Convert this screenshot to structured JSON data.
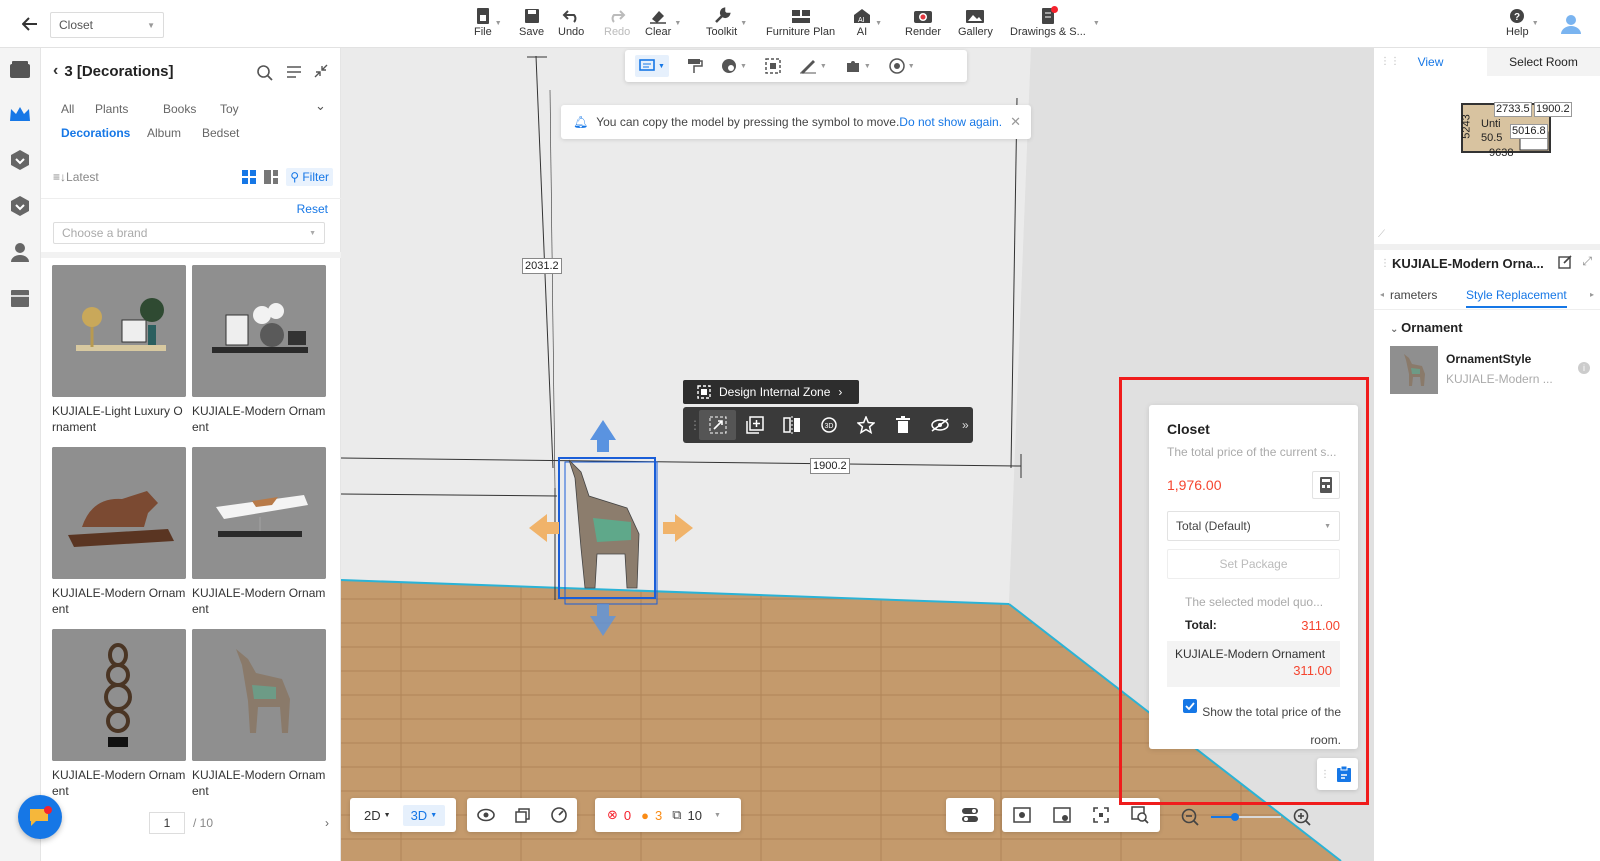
{
  "top": {
    "project": "Closet",
    "tools": [
      {
        "label": "File",
        "icon": "file-icon"
      },
      {
        "label": "Save",
        "icon": "save-icon"
      },
      {
        "label": "Undo",
        "icon": "undo-icon"
      },
      {
        "label": "Redo",
        "icon": "redo-icon"
      },
      {
        "label": "Clear",
        "icon": "eraser-icon"
      },
      {
        "label": "Toolkit",
        "icon": "wrench-icon"
      },
      {
        "label": "Furniture Plan",
        "icon": "furniture-icon"
      },
      {
        "label": "AI",
        "icon": "ai-icon"
      },
      {
        "label": "Render",
        "icon": "camera-icon"
      },
      {
        "label": "Gallery",
        "icon": "gallery-icon"
      },
      {
        "label": "Drawings & S...",
        "icon": "drawings-icon"
      },
      {
        "label": "Help",
        "icon": "help-icon"
      }
    ]
  },
  "library": {
    "title": "3 [Decorations]",
    "categories": [
      "All",
      "Plants",
      "Books",
      "Toy",
      "Decorations",
      "Album",
      "Bedset"
    ],
    "active_category": "Decorations",
    "sort": "Latest",
    "filter": "Filter",
    "reset": "Reset",
    "brand_placeholder": "Choose a brand",
    "items": [
      {
        "name": "KUJIALE-Light Luxury Ornament"
      },
      {
        "name": "KUJIALE-Modern Ornament"
      },
      {
        "name": "KUJIALE-Modern Ornament"
      },
      {
        "name": "KUJIALE-Modern Ornament"
      },
      {
        "name": "KUJIALE-Modern Ornament"
      },
      {
        "name": "KUJIALE-Modern Ornament"
      }
    ],
    "page": "1",
    "page_total": "/ 10"
  },
  "canvas": {
    "notice_text": "You can copy the model by pressing the symbol to move.",
    "notice_link": "Do not show again.",
    "dim_height": "2031.2",
    "dim_width": "1900.2",
    "zone_button": "Design Internal Zone",
    "modes": {
      "m2d": "2D",
      "m3d": "3D"
    },
    "errors": "0",
    "warnings": "3",
    "rooms": "10"
  },
  "price": {
    "title": "Closet",
    "subtitle": "The total price of the current s...",
    "total": "1,976.00",
    "select": "Total (Default)",
    "package": "Set Package",
    "quote_note": "The selected model quo...",
    "total_label": "Total:",
    "total_value": "311.00",
    "item_name": "KUJIALE-Modern Ornament",
    "item_price": "311.00",
    "show_total": "Show the total price of the room."
  },
  "right": {
    "tab_view": "View",
    "tab_select": "Select Room",
    "map_labels": {
      "a": "2733.5",
      "b": "1900.2",
      "c": "5016.8",
      "d": "9638",
      "e": "5243",
      "f": "Unti",
      "g": "50.5"
    },
    "title": "KUJIALE-Modern Orna...",
    "tab_params": "rameters",
    "tab_style": "Style Replacement",
    "section": "Ornament",
    "item_name": "OrnamentStyle",
    "item_sub": "KUJIALE-Modern ..."
  }
}
